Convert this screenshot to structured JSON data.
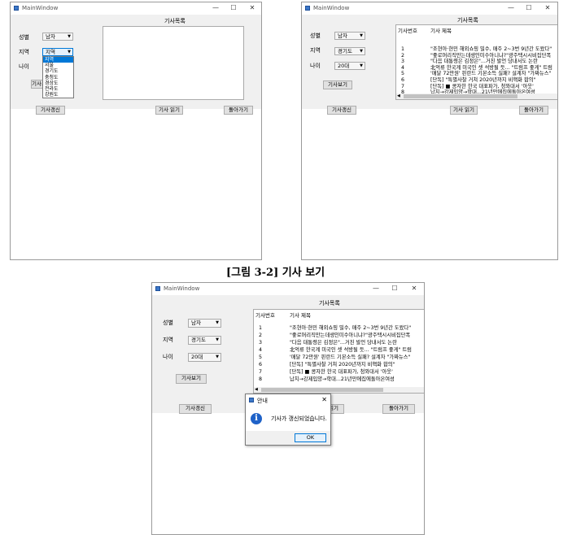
{
  "window": {
    "title": "MainWindow",
    "minimize": "—",
    "maximize": "☐",
    "close": "✕"
  },
  "form": {
    "header": "기사목록",
    "gender_label": "성별",
    "region_label": "지역",
    "age_label": "나이",
    "gender_value": "남자",
    "region_value_panel1": "지역",
    "region_value": "경기도",
    "age_value": "20대",
    "view_button": "기사보기",
    "refresh_button": "기사갱신",
    "read_button": "기사 읽기",
    "back_button": "돌아가기"
  },
  "dropdown": {
    "items": [
      "지역",
      "서울",
      "경기도",
      "충청도",
      "경상도",
      "전라도",
      "강원도"
    ],
    "selected_index": 0
  },
  "list": {
    "col_num": "기사번호",
    "col_title": "기사 제목",
    "rows": [
      {
        "num": "1",
        "title": "\"조현아·현민 해외쇼핑 밀수, 매주 2~3번 9년간 도왔다\""
      },
      {
        "num": "2",
        "title": "\"좋로머리직만는데생인미수아니냐?\"광주택시시비집단폭"
      },
      {
        "num": "3",
        "title": "\"다음 대통령은 김정은\"...거친 발언 당내서도 논란"
      },
      {
        "num": "4",
        "title": "北억류 한국계 미국인 셋 석방될 듯... \"트럼프 좋게\" 트럼"
      },
      {
        "num": "5",
        "title": "'매달 72만원' 핀란드 기본소득 실패? 설계자 \"가짜뉴스\""
      },
      {
        "num": "6",
        "title": "[단독] \"특별사찰 거쳐 2020년까지 비핵화 합의\""
      },
      {
        "num": "7",
        "title": "[단독] ■ 콩자한 한국 대표파가, 청와대서 '아웃'"
      },
      {
        "num": "8",
        "title": "납치→강제입양→학대...21년만에집에돌아온여성"
      }
    ]
  },
  "caption": "[그림 3-2] 기사 보기",
  "dialog": {
    "title": "안내",
    "message": "기사가 갱신되었습니다.",
    "ok": "OK",
    "close": "✕",
    "icon": "info-icon"
  }
}
